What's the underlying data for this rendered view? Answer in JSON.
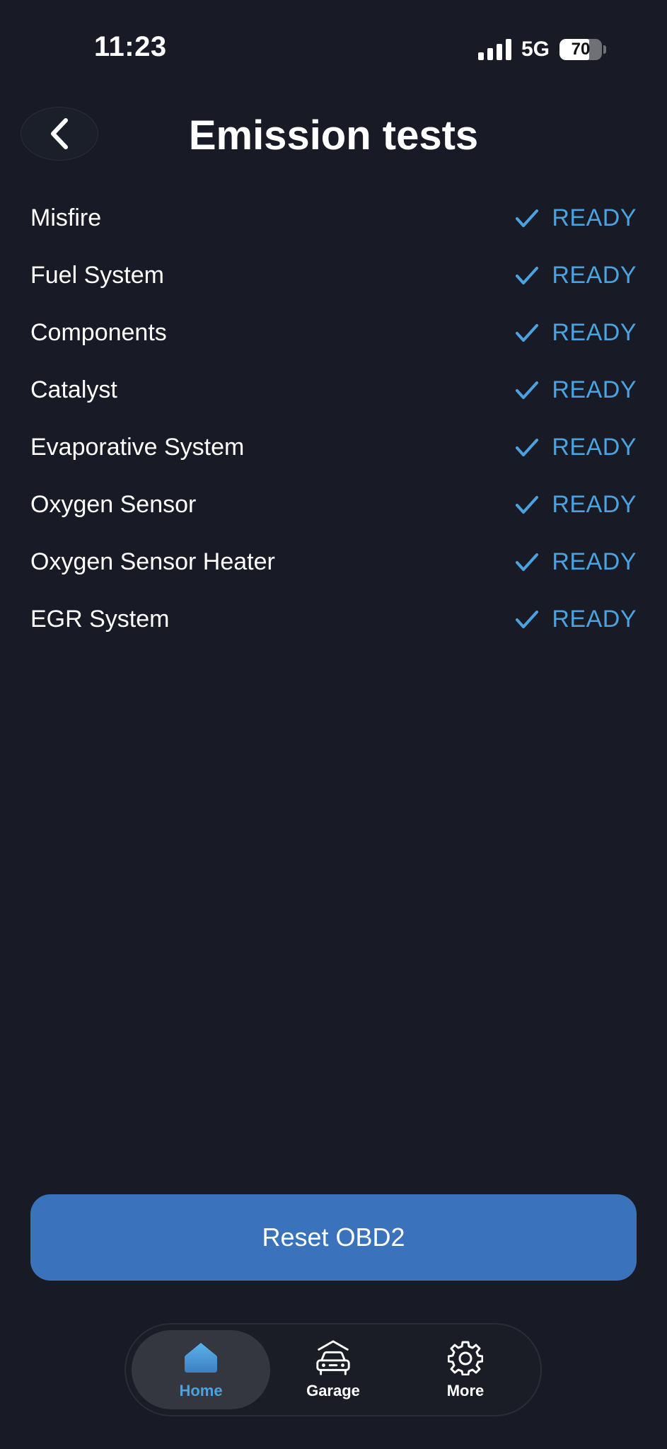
{
  "status_bar": {
    "time": "11:23",
    "network": "5G",
    "battery": "70",
    "battery_level": 0.7
  },
  "header": {
    "title": "Emission tests"
  },
  "tests": [
    {
      "name": "Misfire",
      "status": "READY"
    },
    {
      "name": "Fuel System",
      "status": "READY"
    },
    {
      "name": "Components",
      "status": "READY"
    },
    {
      "name": "Catalyst",
      "status": "READY"
    },
    {
      "name": "Evaporative System",
      "status": "READY"
    },
    {
      "name": "Oxygen Sensor",
      "status": "READY"
    },
    {
      "name": "Oxygen Sensor Heater",
      "status": "READY"
    },
    {
      "name": "EGR System",
      "status": "READY"
    }
  ],
  "reset_button": {
    "label": "Reset OBD2"
  },
  "tab_bar": {
    "tabs": [
      {
        "label": "Home",
        "icon": "home-icon",
        "active": true
      },
      {
        "label": "Garage",
        "icon": "car-icon",
        "active": false
      },
      {
        "label": "More",
        "icon": "gear-icon",
        "active": false
      }
    ]
  },
  "colors": {
    "background": "#181b25",
    "accent": "#4aa3e0",
    "button": "#3a73bb"
  }
}
